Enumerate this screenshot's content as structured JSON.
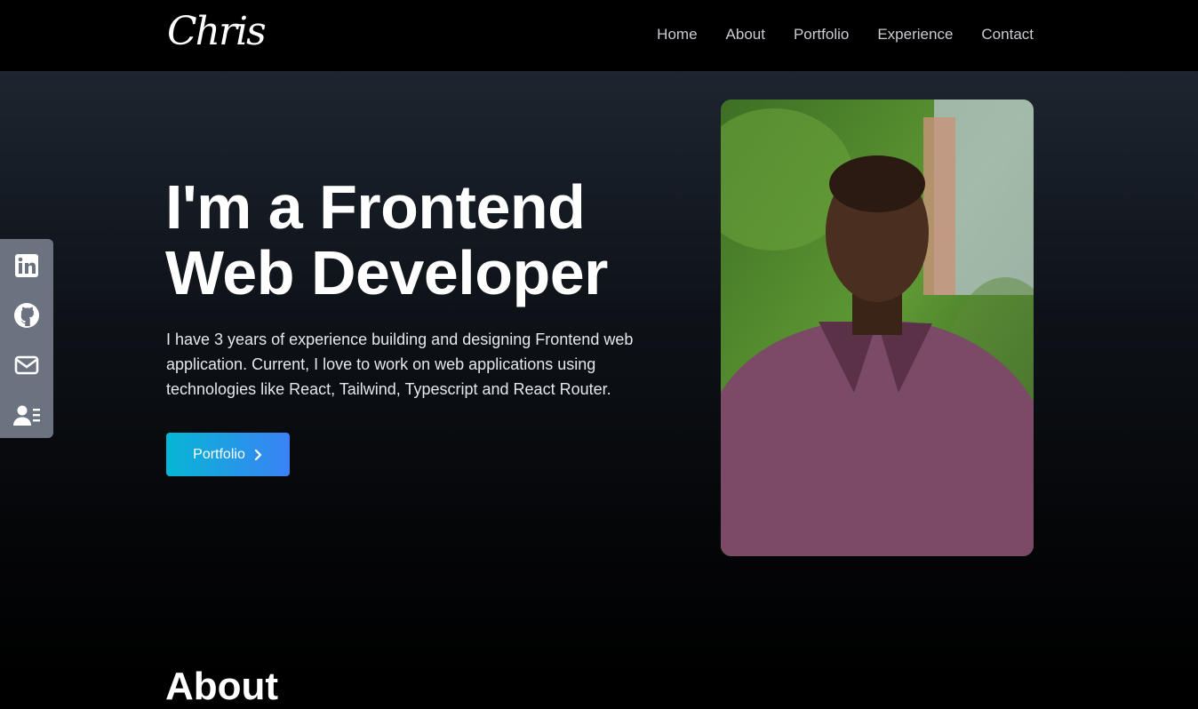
{
  "nav": {
    "logo": "Chris",
    "links": [
      "Home",
      "About",
      "Portfolio",
      "Experience",
      "Contact"
    ]
  },
  "social": {
    "icons": [
      "linkedin-icon",
      "github-icon",
      "mail-icon",
      "resume-icon"
    ]
  },
  "hero": {
    "headline_line1": "I'm a Frontend",
    "headline_line2": "Web Developer",
    "intro": "I have 3 years of experience building and designing Frontend web application. Current, I love to work on web applications using technologies like React, Tailwind, Typescript and React Router.",
    "cta_label": "Portfolio"
  },
  "about": {
    "title": "About"
  },
  "colors": {
    "cta_start": "#06b6d4",
    "cta_end": "#3b82f6",
    "social_bar": "#6b7280"
  }
}
